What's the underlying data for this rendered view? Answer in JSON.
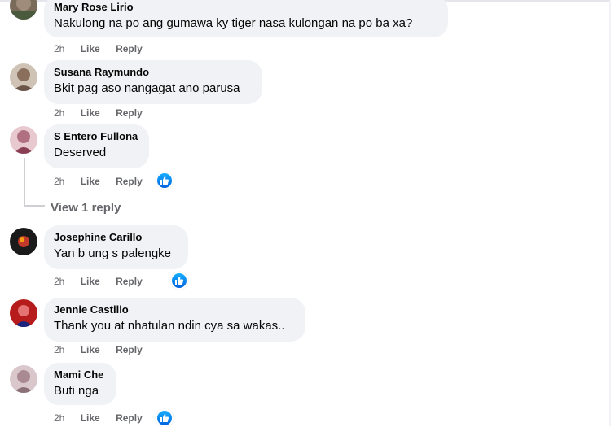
{
  "comments": [
    {
      "author": "Mary Rose Lirio",
      "text": "Nakulong na po ang gumawa ky tiger nasa kulongan na po ba xa?",
      "time": "2h",
      "like": "Like",
      "reply": "Reply"
    },
    {
      "author": "Susana Raymundo",
      "text": "Bkit pag aso nangagat ano parusa",
      "time": "2h",
      "like": "Like",
      "reply": "Reply"
    },
    {
      "author": "S Entero Fullona",
      "text": "Deserved",
      "time": "2h",
      "like": "Like",
      "reply": "Reply",
      "reaction": "like"
    },
    {
      "author": "Josephine Carillo",
      "text": "Yan b ung s palengke",
      "time": "2h",
      "like": "Like",
      "reply": "Reply",
      "reaction": "like"
    },
    {
      "author": "Jennie Castillo",
      "text": "Thank you at nhatulan ndin cya sa wakas..",
      "time": "2h",
      "like": "Like",
      "reply": "Reply"
    },
    {
      "author": "Mami Che",
      "text": "Buti nga",
      "time": "2h",
      "like": "Like",
      "reply": "Reply",
      "reaction": "like"
    }
  ],
  "view_replies": "View 1 reply",
  "colors": {
    "bubble": "#f0f2f5",
    "meta": "#65676b",
    "like_blue": "#0866ff"
  }
}
